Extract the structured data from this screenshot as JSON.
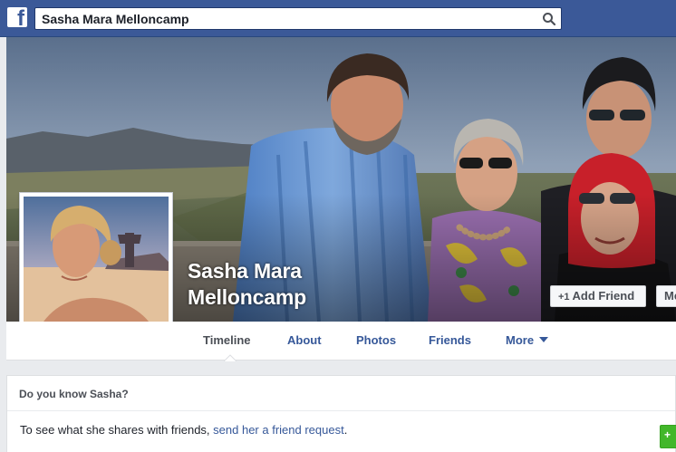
{
  "topbar": {
    "logo_letter": "f",
    "search_value": "Sasha Mara Melloncamp",
    "search_icon": "search-icon"
  },
  "profile": {
    "name_line1": "Sasha Mara",
    "name_line2": "Melloncamp"
  },
  "actions": {
    "add_friend_label": "Add Friend",
    "add_friend_icon": "+1",
    "message_label": "Me"
  },
  "tabs": [
    {
      "label": "Timeline",
      "active": true
    },
    {
      "label": "About"
    },
    {
      "label": "Photos"
    },
    {
      "label": "Friends"
    },
    {
      "label": "More"
    }
  ],
  "know_panel": {
    "heading": "Do you know Sasha?",
    "text_prefix": "To see what she shares with friends, ",
    "link_text": "send her a friend request",
    "text_suffix": "."
  },
  "colors": {
    "brand_blue": "#3b5998",
    "link_blue": "#365899",
    "green": "#42b72a"
  }
}
